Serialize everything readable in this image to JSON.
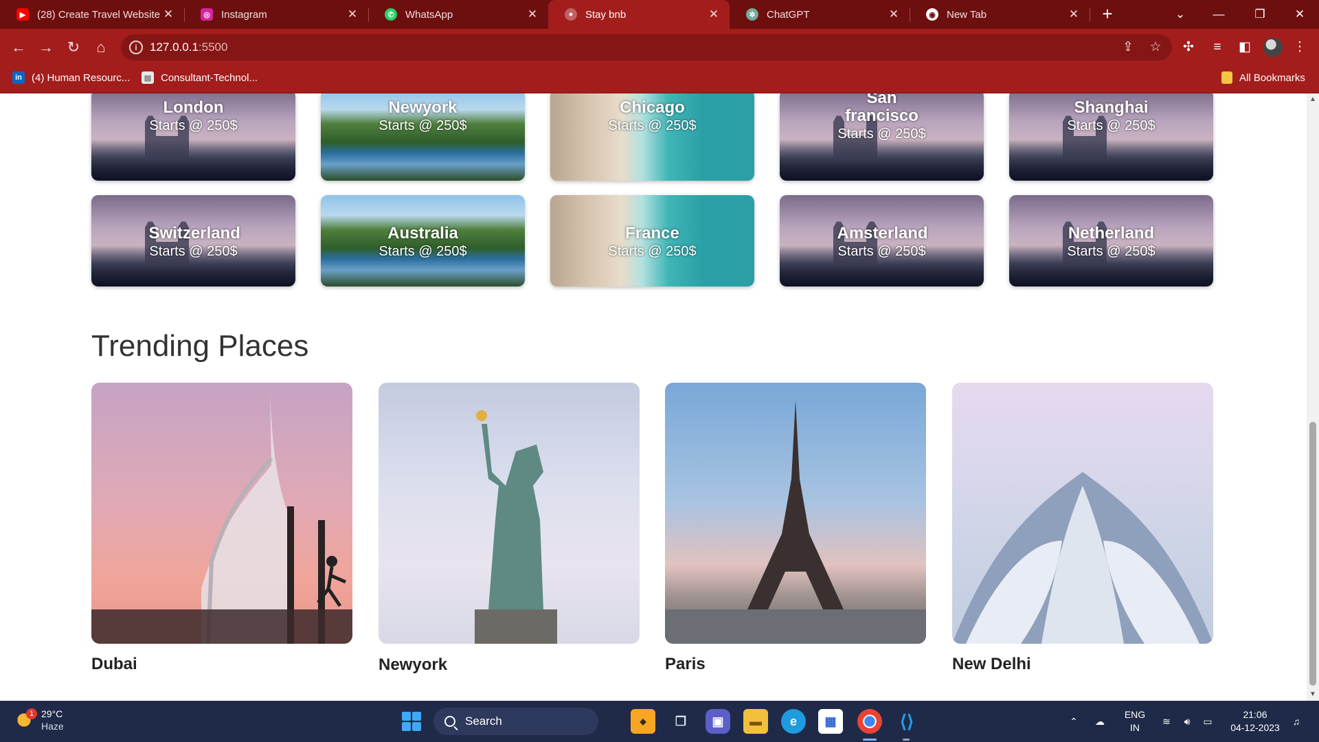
{
  "browser": {
    "tabs": [
      {
        "title": "(28) Create Travel Website",
        "icon": "youtube-icon",
        "color": "#ff0000",
        "glyph": "▶"
      },
      {
        "title": "Instagram",
        "icon": "instagram-icon",
        "color": "#d6249f",
        "glyph": "◎"
      },
      {
        "title": "WhatsApp",
        "icon": "whatsapp-icon",
        "color": "#25d366",
        "glyph": "✆"
      },
      {
        "title": "Stay bnb",
        "icon": "globe-icon",
        "color": "#c46060",
        "glyph": "●"
      },
      {
        "title": "ChatGPT",
        "icon": "chatgpt-icon",
        "color": "#74aa9c",
        "glyph": "✲"
      },
      {
        "title": "New Tab",
        "icon": "chrome-icon",
        "color": "#ffffff",
        "glyph": "◉"
      }
    ],
    "active_tab": 3,
    "url_host": "127.0.0.1",
    "url_port": ":5500",
    "bookmarks": [
      {
        "label": "(4) Human Resourc...",
        "icon": "linkedin-icon",
        "glyph": "in",
        "color": "#0a66c2"
      },
      {
        "label": "Consultant-Technol...",
        "icon": "document-icon",
        "glyph": "▤",
        "color": "#e8e8e8"
      }
    ],
    "all_bookmarks": "All Bookmarks"
  },
  "page": {
    "cities_row1": [
      {
        "name": "London",
        "price": "Starts @ 250$",
        "image": "bridge"
      },
      {
        "name": "Newyork",
        "price": "Starts @ 250$",
        "image": "lake"
      },
      {
        "name": "Chicago",
        "price": "Starts @ 250$",
        "image": "beach"
      },
      {
        "name": "San francisco",
        "price": "Starts @ 250$",
        "image": "bridge"
      },
      {
        "name": "Shanghai",
        "price": "Starts @ 250$",
        "image": "bridge"
      }
    ],
    "cities_row2": [
      {
        "name": "Switzerland",
        "price": "Starts @ 250$",
        "image": "bridge"
      },
      {
        "name": "Australia",
        "price": "Starts @ 250$",
        "image": "lake"
      },
      {
        "name": "France",
        "price": "Starts @ 250$",
        "image": "beach"
      },
      {
        "name": "Amsterland",
        "price": "Starts @ 250$",
        "image": "bridge"
      },
      {
        "name": "Netherland",
        "price": "Starts @ 250$",
        "image": "bridge"
      }
    ],
    "trending_title": "Trending Places",
    "trending": [
      {
        "name": "Dubai",
        "image": "dubai"
      },
      {
        "name": "Newyork",
        "image": "liberty"
      },
      {
        "name": "Paris",
        "image": "paris"
      },
      {
        "name": "New Delhi",
        "image": "lotus"
      }
    ]
  },
  "taskbar": {
    "weather_temp": "29°C",
    "weather_desc": "Haze",
    "weather_badge": "1",
    "search_label": "Search",
    "lang_top": "ENG",
    "lang_bottom": "IN",
    "time": "21:06",
    "date": "04-12-2023"
  }
}
